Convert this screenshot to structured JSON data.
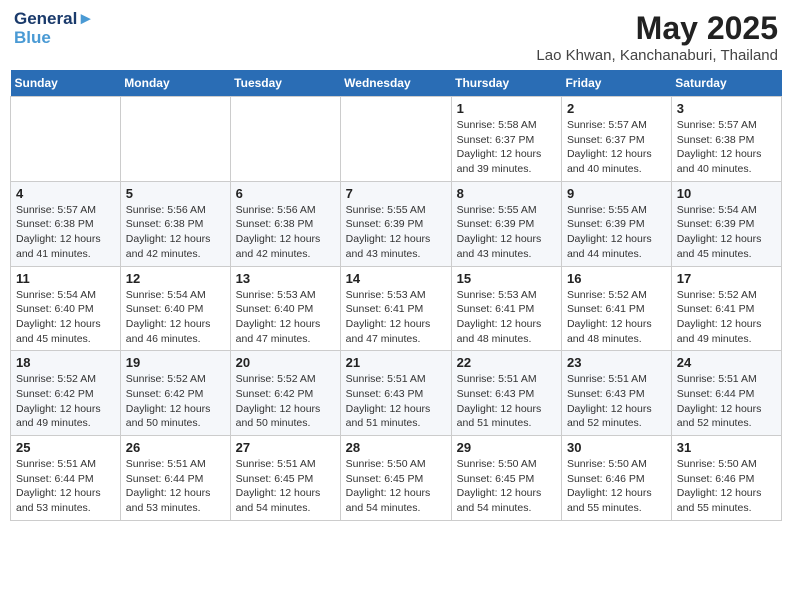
{
  "header": {
    "logo_line1": "General",
    "logo_line2": "Blue",
    "month_year": "May 2025",
    "location": "Lao Khwan, Kanchanaburi, Thailand"
  },
  "weekdays": [
    "Sunday",
    "Monday",
    "Tuesday",
    "Wednesday",
    "Thursday",
    "Friday",
    "Saturday"
  ],
  "weeks": [
    [
      {
        "day": "",
        "info": ""
      },
      {
        "day": "",
        "info": ""
      },
      {
        "day": "",
        "info": ""
      },
      {
        "day": "",
        "info": ""
      },
      {
        "day": "1",
        "info": "Sunrise: 5:58 AM\nSunset: 6:37 PM\nDaylight: 12 hours\nand 39 minutes."
      },
      {
        "day": "2",
        "info": "Sunrise: 5:57 AM\nSunset: 6:37 PM\nDaylight: 12 hours\nand 40 minutes."
      },
      {
        "day": "3",
        "info": "Sunrise: 5:57 AM\nSunset: 6:38 PM\nDaylight: 12 hours\nand 40 minutes."
      }
    ],
    [
      {
        "day": "4",
        "info": "Sunrise: 5:57 AM\nSunset: 6:38 PM\nDaylight: 12 hours\nand 41 minutes."
      },
      {
        "day": "5",
        "info": "Sunrise: 5:56 AM\nSunset: 6:38 PM\nDaylight: 12 hours\nand 42 minutes."
      },
      {
        "day": "6",
        "info": "Sunrise: 5:56 AM\nSunset: 6:38 PM\nDaylight: 12 hours\nand 42 minutes."
      },
      {
        "day": "7",
        "info": "Sunrise: 5:55 AM\nSunset: 6:39 PM\nDaylight: 12 hours\nand 43 minutes."
      },
      {
        "day": "8",
        "info": "Sunrise: 5:55 AM\nSunset: 6:39 PM\nDaylight: 12 hours\nand 43 minutes."
      },
      {
        "day": "9",
        "info": "Sunrise: 5:55 AM\nSunset: 6:39 PM\nDaylight: 12 hours\nand 44 minutes."
      },
      {
        "day": "10",
        "info": "Sunrise: 5:54 AM\nSunset: 6:39 PM\nDaylight: 12 hours\nand 45 minutes."
      }
    ],
    [
      {
        "day": "11",
        "info": "Sunrise: 5:54 AM\nSunset: 6:40 PM\nDaylight: 12 hours\nand 45 minutes."
      },
      {
        "day": "12",
        "info": "Sunrise: 5:54 AM\nSunset: 6:40 PM\nDaylight: 12 hours\nand 46 minutes."
      },
      {
        "day": "13",
        "info": "Sunrise: 5:53 AM\nSunset: 6:40 PM\nDaylight: 12 hours\nand 47 minutes."
      },
      {
        "day": "14",
        "info": "Sunrise: 5:53 AM\nSunset: 6:41 PM\nDaylight: 12 hours\nand 47 minutes."
      },
      {
        "day": "15",
        "info": "Sunrise: 5:53 AM\nSunset: 6:41 PM\nDaylight: 12 hours\nand 48 minutes."
      },
      {
        "day": "16",
        "info": "Sunrise: 5:52 AM\nSunset: 6:41 PM\nDaylight: 12 hours\nand 48 minutes."
      },
      {
        "day": "17",
        "info": "Sunrise: 5:52 AM\nSunset: 6:41 PM\nDaylight: 12 hours\nand 49 minutes."
      }
    ],
    [
      {
        "day": "18",
        "info": "Sunrise: 5:52 AM\nSunset: 6:42 PM\nDaylight: 12 hours\nand 49 minutes."
      },
      {
        "day": "19",
        "info": "Sunrise: 5:52 AM\nSunset: 6:42 PM\nDaylight: 12 hours\nand 50 minutes."
      },
      {
        "day": "20",
        "info": "Sunrise: 5:52 AM\nSunset: 6:42 PM\nDaylight: 12 hours\nand 50 minutes."
      },
      {
        "day": "21",
        "info": "Sunrise: 5:51 AM\nSunset: 6:43 PM\nDaylight: 12 hours\nand 51 minutes."
      },
      {
        "day": "22",
        "info": "Sunrise: 5:51 AM\nSunset: 6:43 PM\nDaylight: 12 hours\nand 51 minutes."
      },
      {
        "day": "23",
        "info": "Sunrise: 5:51 AM\nSunset: 6:43 PM\nDaylight: 12 hours\nand 52 minutes."
      },
      {
        "day": "24",
        "info": "Sunrise: 5:51 AM\nSunset: 6:44 PM\nDaylight: 12 hours\nand 52 minutes."
      }
    ],
    [
      {
        "day": "25",
        "info": "Sunrise: 5:51 AM\nSunset: 6:44 PM\nDaylight: 12 hours\nand 53 minutes."
      },
      {
        "day": "26",
        "info": "Sunrise: 5:51 AM\nSunset: 6:44 PM\nDaylight: 12 hours\nand 53 minutes."
      },
      {
        "day": "27",
        "info": "Sunrise: 5:51 AM\nSunset: 6:45 PM\nDaylight: 12 hours\nand 54 minutes."
      },
      {
        "day": "28",
        "info": "Sunrise: 5:50 AM\nSunset: 6:45 PM\nDaylight: 12 hours\nand 54 minutes."
      },
      {
        "day": "29",
        "info": "Sunrise: 5:50 AM\nSunset: 6:45 PM\nDaylight: 12 hours\nand 54 minutes."
      },
      {
        "day": "30",
        "info": "Sunrise: 5:50 AM\nSunset: 6:46 PM\nDaylight: 12 hours\nand 55 minutes."
      },
      {
        "day": "31",
        "info": "Sunrise: 5:50 AM\nSunset: 6:46 PM\nDaylight: 12 hours\nand 55 minutes."
      }
    ]
  ]
}
